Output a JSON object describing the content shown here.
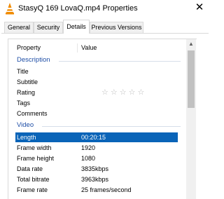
{
  "window": {
    "title": "StasyQ 169 LovaQ.mp4 Properties",
    "close_glyph": "✕"
  },
  "tabs": [
    {
      "label": "General",
      "active": false
    },
    {
      "label": "Security",
      "active": false
    },
    {
      "label": "Details",
      "active": true
    },
    {
      "label": "Previous Versions",
      "active": false
    }
  ],
  "columns": {
    "property": "Property",
    "value": "Value"
  },
  "groups": {
    "description": "Description",
    "video": "Video"
  },
  "description_rows": [
    {
      "name": "Title",
      "value": ""
    },
    {
      "name": "Subtitle",
      "value": ""
    },
    {
      "name": "Rating",
      "value": ""
    },
    {
      "name": "Tags",
      "value": ""
    },
    {
      "name": "Comments",
      "value": ""
    }
  ],
  "rating": {
    "stars": "☆☆☆☆☆",
    "value": 0,
    "max": 5
  },
  "video_rows": [
    {
      "name": "Length",
      "value": "00:20:15",
      "selected": true
    },
    {
      "name": "Frame width",
      "value": "1920"
    },
    {
      "name": "Frame height",
      "value": "1080"
    },
    {
      "name": "Data rate",
      "value": "3835kbps"
    },
    {
      "name": "Total bitrate",
      "value": "3963kbps"
    },
    {
      "name": "Frame rate",
      "value": "25 frames/second"
    }
  ],
  "colors": {
    "group_header": "#1e4ea6",
    "selection": "#0a64b8",
    "icon_orange": "#f08a00"
  },
  "icons": {
    "app": "vlc-cone-icon",
    "scroll_up": "▲"
  }
}
